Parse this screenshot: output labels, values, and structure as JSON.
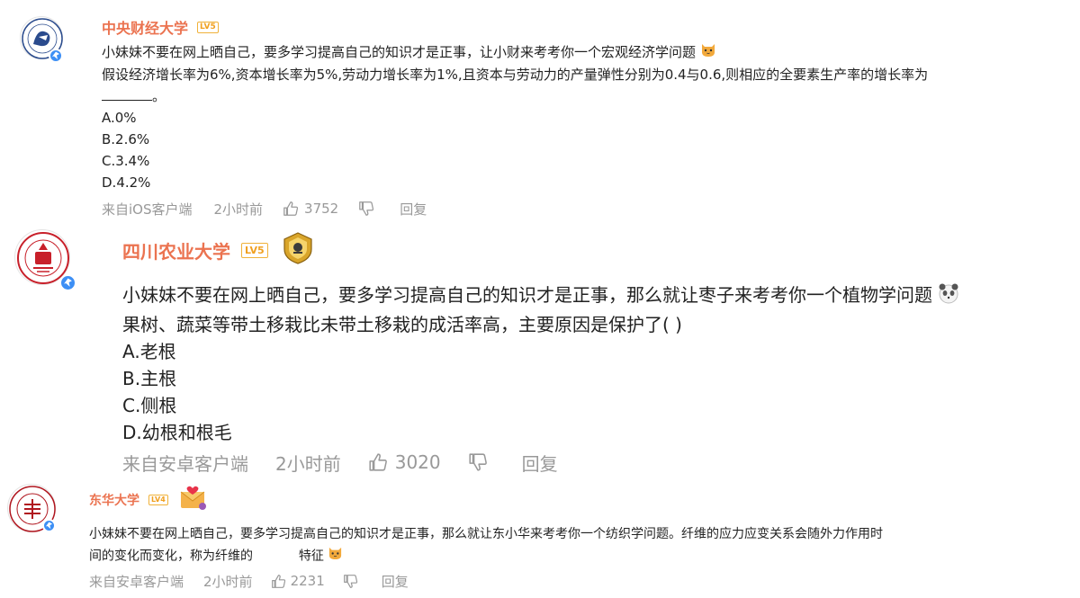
{
  "comments": [
    {
      "username": "中央财经大学",
      "level": "LV5",
      "text_lines": [
        "小妹妹不要在网上晒自己，要多学习提高自己的知识才是正事，让小财来考考你一个宏观经济学问题",
        "假设经济增长率为6%,资本增长率为5%,劳动力增长率为1%,且资本与劳动力的产量弹性分别为0.4与0.6,则相应的全要素生产率的增长率为",
        "。",
        "A.0%",
        "B.2.6%",
        "C.3.4%",
        "D.4.2%"
      ],
      "meta": {
        "source": "来自iOS客户端",
        "time": "2小时前",
        "likes": "3752",
        "reply": "回复"
      },
      "icons": {
        "emoji": "cat-face-emoji",
        "like": "thumb-up-icon",
        "dislike": "thumb-down-icon",
        "verified": "verified-badge-icon"
      }
    },
    {
      "username": "四川农业大学",
      "level": "LV5",
      "text_lines": [
        "小妹妹不要在网上晒自己，要多学习提高自己的知识才是正事，那么就让枣子来考考你一个植物学问题",
        "果树、蔬菜等带土移栽比未带土移栽的成活率高，主要原因是保护了( )",
        "A.老根",
        "B.主根",
        "C.侧根",
        "D.幼根和根毛"
      ],
      "meta": {
        "source": "来自安卓客户端",
        "time": "2小时前",
        "likes": "3020",
        "reply": "回复"
      },
      "icons": {
        "emoji": "panda-face-emoji",
        "medal": "honor-medal-icon",
        "like": "thumb-up-icon",
        "dislike": "thumb-down-icon",
        "verified": "verified-badge-icon"
      }
    },
    {
      "username": "东华大学",
      "level": "LV4",
      "text_lines": [
        "小妹妹不要在网上晒自己，要多学习提高自己的知识才是正事，那么就让东小华来考考你一个纺织学问题。纤维的应力应变关系会随外力作用时",
        "间的变化而变化，称为纤维的",
        "特征"
      ],
      "meta": {
        "source": "来自安卓客户端",
        "time": "2小时前",
        "likes": "2231",
        "reply": "回复"
      },
      "icons": {
        "emoji": "cat-face-emoji",
        "medal": "love-letter-icon",
        "like": "thumb-up-icon",
        "dislike": "thumb-down-icon",
        "verified": "verified-badge-icon"
      }
    }
  ],
  "colors": {
    "username": "#eb7350",
    "meta": "#999999",
    "level_badge": "#f0a020",
    "verified": "#3d8ff5"
  }
}
